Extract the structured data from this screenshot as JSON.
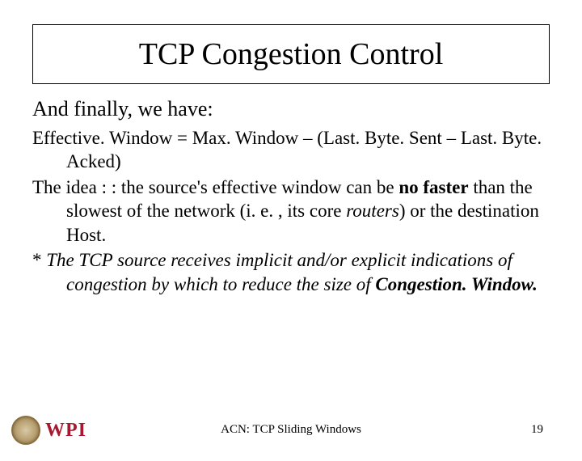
{
  "title": "TCP Congestion Control",
  "intro": "And finally, we have:",
  "p1": {
    "a": "Effective. Window = Max. Window – (Last. Byte. Sent – Last. Byte. Acked)",
    "dummy": ""
  },
  "p2": {
    "a": "The idea : : the source's effective window can be ",
    "b": "no faster",
    "c": " than the slowest of the network (i. e. , its core ",
    "d": "routers",
    "e": ") or the destination Host."
  },
  "p3": {
    "a": "*  ",
    "b": "The TCP source receives implicit  and/or explicit indications  of congestion by which to reduce  the size of ",
    "c": "Congestion. Window."
  },
  "footer": {
    "center": "ACN: TCP Sliding Windows",
    "page": "19",
    "logo": "WPI"
  }
}
